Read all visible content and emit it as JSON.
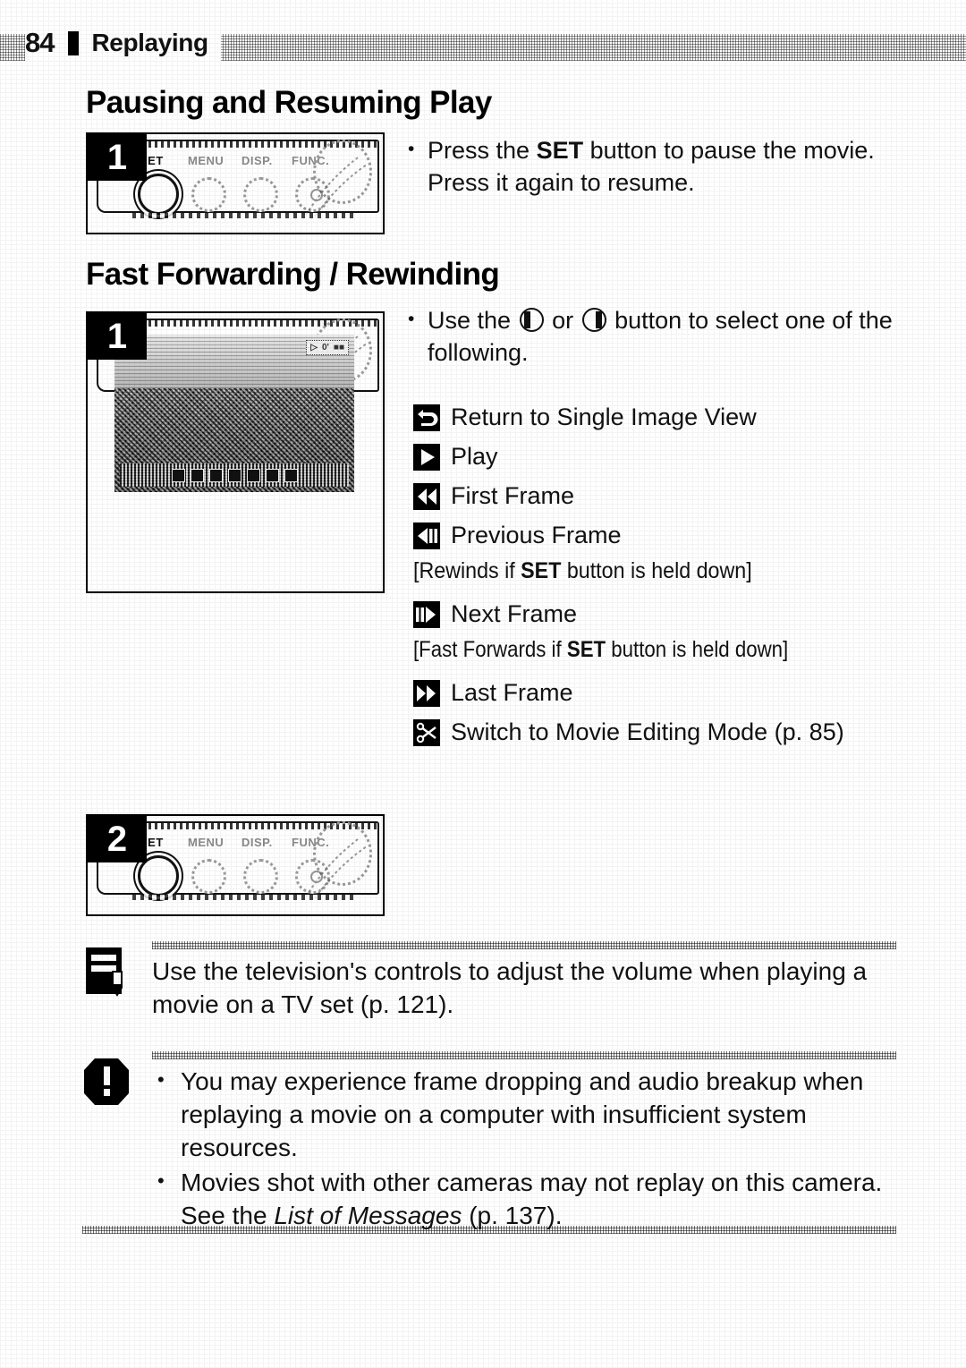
{
  "header": {
    "page_number": "84",
    "chapter": "Replaying"
  },
  "sections": [
    {
      "id": "pausing",
      "heading": "Pausing and Resuming Play",
      "step_number": "1",
      "bullet": {
        "pre": "Press the ",
        "bold": "SET",
        "post": " button to pause the movie. Press it again to resume."
      }
    },
    {
      "id": "fast-forwarding",
      "heading": "Fast Forwarding / Rewinding",
      "step_number": "1",
      "step2_number": "2",
      "bullet": {
        "pre": "Use the ",
        "mid": " or ",
        "post": " button to select one of the following."
      }
    }
  ],
  "camera_photo": {
    "button_labels": [
      "SET",
      "MENU",
      "DISP.",
      "FUNC."
    ]
  },
  "lcd": {
    "status_icons": [
      "movie-icon",
      "time-icon",
      "battery-icon"
    ],
    "playback_bar_icons": [
      "return",
      "play",
      "first-frame",
      "previous-frame",
      "next-frame",
      "last-frame",
      "scissors"
    ]
  },
  "options": [
    {
      "icon": "return-arrow-icon",
      "label": "Return to Single Image View",
      "note": ""
    },
    {
      "icon": "play-icon",
      "label": "Play",
      "note": ""
    },
    {
      "icon": "first-frame-icon",
      "label": "First Frame",
      "note": ""
    },
    {
      "icon": "previous-frame-icon",
      "label": "Previous Frame",
      "note_pre": "[Rewinds if ",
      "note_bold": "SET",
      "note_post": " button is held down]"
    },
    {
      "icon": "next-frame-icon",
      "label": "Next Frame",
      "note_pre": "[Fast Forwards if ",
      "note_bold": "SET",
      "note_post": " button is held down]"
    },
    {
      "icon": "last-frame-icon",
      "label": "Last Frame",
      "note": ""
    },
    {
      "icon": "scissors-icon",
      "label": "Switch to Movie Editing Mode (p. 85)",
      "note": ""
    }
  ],
  "note_box": {
    "icon": "note-pencil-icon",
    "text": "Use the television's controls to adjust the volume when playing a movie on a TV set (p. 121)."
  },
  "caution_box": {
    "icon": "exclamation-icon",
    "bullets": [
      {
        "text": "You may experience frame dropping and audio breakup when replaying a movie on a computer with insufficient system resources."
      },
      {
        "pre": "Movies shot with other cameras may not replay on this camera. See the ",
        "italic": "List of Messages",
        "post": " (p. 137)."
      }
    ]
  }
}
